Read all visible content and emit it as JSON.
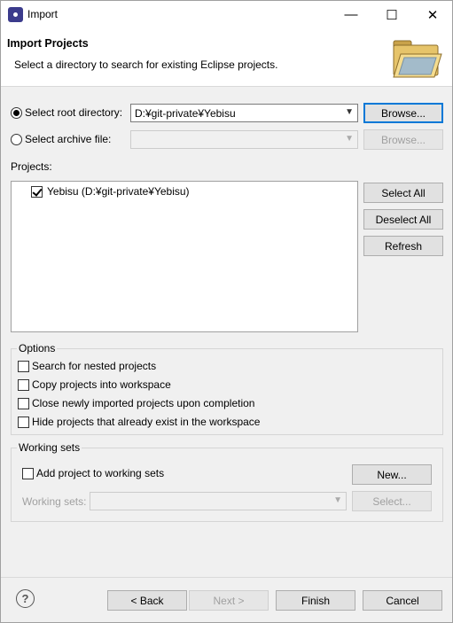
{
  "window": {
    "title": "Import",
    "minimize_glyph": "—",
    "maximize_glyph": "☐",
    "close_glyph": "✕"
  },
  "header": {
    "title": "Import Projects",
    "description": "Select a directory to search for existing Eclipse projects."
  },
  "source": {
    "root_dir_label": "Select root directory:",
    "root_dir_value": "D:¥git-private¥Yebisu",
    "root_browse_label": "Browse...",
    "archive_label": "Select archive file:",
    "archive_value": "",
    "archive_browse_label": "Browse..."
  },
  "projects": {
    "label": "Projects:",
    "items": [
      {
        "label": "Yebisu (D:¥git-private¥Yebisu)",
        "checked": true
      }
    ],
    "select_all_label": "Select All",
    "deselect_all_label": "Deselect All",
    "refresh_label": "Refresh"
  },
  "options": {
    "title": "Options",
    "items": [
      {
        "label": "Search for nested projects",
        "checked": false
      },
      {
        "label": "Copy projects into workspace",
        "checked": false
      },
      {
        "label": "Close newly imported projects upon completion",
        "checked": false
      },
      {
        "label": "Hide projects that already exist in the workspace",
        "checked": false
      }
    ]
  },
  "working_sets": {
    "title": "Working sets",
    "add_label": "Add project to working sets",
    "add_checked": false,
    "new_label": "New...",
    "sets_label": "Working sets:",
    "sets_value": "",
    "select_label": "Select..."
  },
  "footer": {
    "help_glyph": "?",
    "back_label": "< Back",
    "next_label": "Next >",
    "finish_label": "Finish",
    "cancel_label": "Cancel"
  },
  "icons": {
    "app": "eclipse-icon",
    "wizard": "folder-icon",
    "help": "help-icon"
  }
}
